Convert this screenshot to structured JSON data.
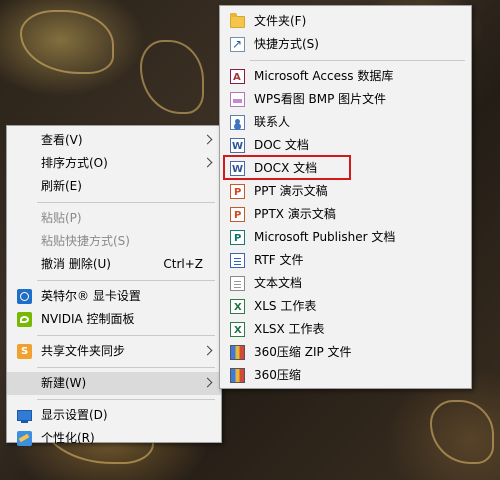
{
  "context_menu": {
    "items": [
      {
        "label": "查看(V)"
      },
      {
        "label": "排序方式(O)"
      },
      {
        "label": "刷新(E)"
      },
      {
        "label": "粘贴(P)"
      },
      {
        "label": "粘贴快捷方式(S)"
      },
      {
        "label": "撤消 删除(U)",
        "shortcut": "Ctrl+Z"
      },
      {
        "label": "英特尔® 显卡设置",
        "icon": "intel-graphics-icon"
      },
      {
        "label": "NVIDIA 控制面板",
        "icon": "nvidia-icon"
      },
      {
        "label": "共享文件夹同步",
        "icon": "share-sync-icon"
      },
      {
        "label": "新建(W)"
      },
      {
        "label": "显示设置(D)",
        "icon": "display-icon"
      },
      {
        "label": "个性化(R)",
        "icon": "personalize-icon"
      }
    ]
  },
  "submenu": {
    "items": [
      {
        "label": "文件夹(F)",
        "icon": "folder-icon"
      },
      {
        "label": "快捷方式(S)",
        "icon": "shortcut-icon"
      },
      {
        "label": "Microsoft Access 数据库",
        "icon": "access-icon"
      },
      {
        "label": "WPS看图 BMP 图片文件",
        "icon": "wps-image-icon"
      },
      {
        "label": "联系人",
        "icon": "contact-icon"
      },
      {
        "label": "DOC 文档",
        "icon": "word-doc-icon"
      },
      {
        "label": "DOCX 文档",
        "icon": "word-docx-icon"
      },
      {
        "label": "PPT 演示文稿",
        "icon": "ppt-icon"
      },
      {
        "label": "PPTX 演示文稿",
        "icon": "pptx-icon"
      },
      {
        "label": "Microsoft Publisher 文档",
        "icon": "publisher-icon"
      },
      {
        "label": "RTF 文件",
        "icon": "rtf-icon"
      },
      {
        "label": "文本文档",
        "icon": "text-doc-icon"
      },
      {
        "label": "XLS 工作表",
        "icon": "xls-icon"
      },
      {
        "label": "XLSX 工作表",
        "icon": "xlsx-icon"
      },
      {
        "label": "360压缩 ZIP 文件",
        "icon": "zip-360-icon"
      },
      {
        "label": "360压缩",
        "icon": "zip-360-icon"
      }
    ]
  },
  "colors": {
    "highlight_box": "#d11a1a",
    "menu_background": "#f2f2f2",
    "hover_background": "#dadada"
  }
}
